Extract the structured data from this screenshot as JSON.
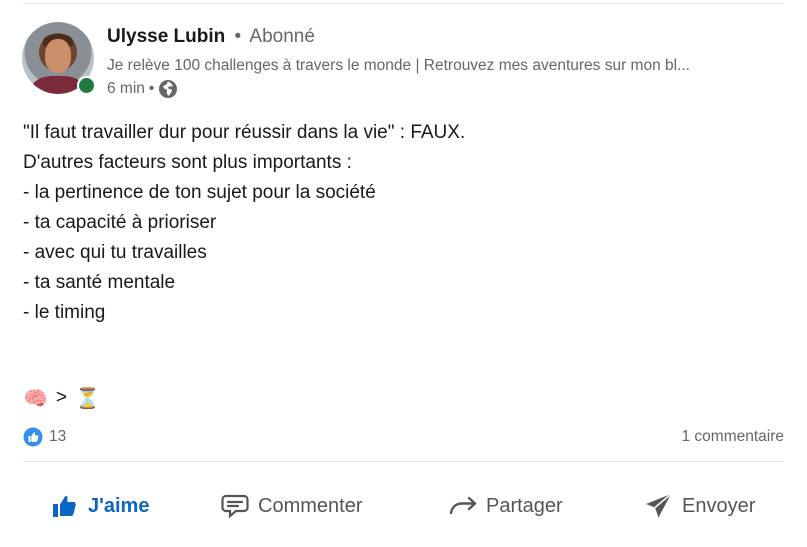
{
  "post": {
    "author": {
      "name": "Ulysse Lubin",
      "separator": "•",
      "follow_status": "Abonné",
      "headline": "Je relève 100 challenges à travers le monde | Retrouvez mes aventures sur mon bl...",
      "time": "6 min",
      "meta_separator": "•",
      "visibility_icon": "globe-icon",
      "online_status_color": "#1f7a3e"
    },
    "text_lines": [
      "\"Il faut travailler dur pour réussir dans la vie\" : FAUX.",
      "",
      "D'autres facteurs sont plus importants :",
      "- la pertinence de ton sujet pour la société",
      "- ta capacité à prioriser",
      "- avec qui tu travailles",
      "- ta santé mentale",
      "- le timing"
    ],
    "emoji_line": {
      "left": "🧠",
      "operator": ">",
      "right": "⏳"
    },
    "stats": {
      "reaction_icon": "like-reaction-icon",
      "reactions_count": "13",
      "comments": "1 commentaire"
    },
    "actions": {
      "like": "J'aime",
      "comment": "Commenter",
      "share": "Partager",
      "send": "Envoyer"
    },
    "colors": {
      "accent": "#0a66c2",
      "secondary_text": "#666666",
      "primary_text": "#191919"
    }
  }
}
